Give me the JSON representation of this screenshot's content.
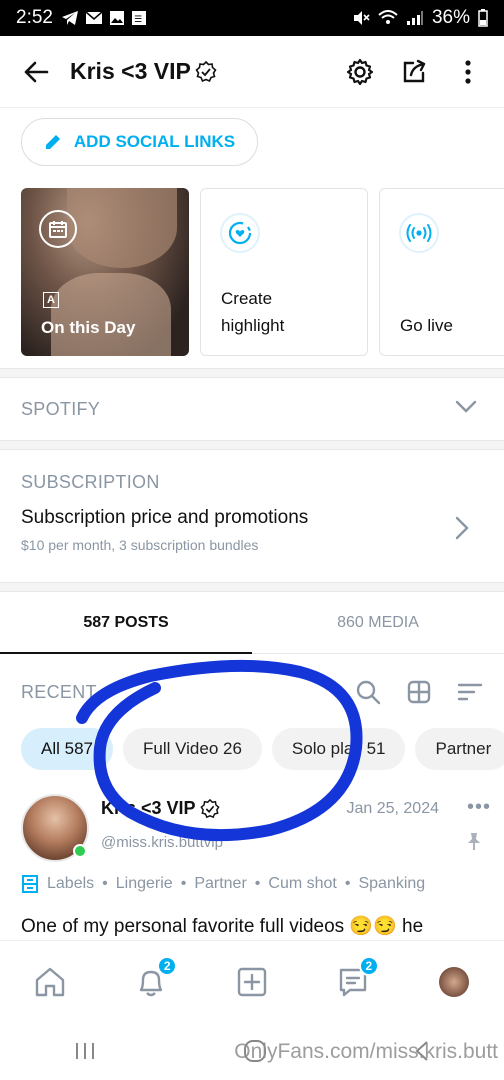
{
  "status_bar": {
    "time": "2:52",
    "battery": "36%"
  },
  "header": {
    "title": "Kris <3 VIP"
  },
  "social": {
    "label": "ADD SOCIAL LINKS"
  },
  "highlights": [
    {
      "label": "On this Day"
    },
    {
      "label": "Create highlight"
    },
    {
      "label": "Go live"
    }
  ],
  "spotify": {
    "title": "SPOTIFY"
  },
  "subscription": {
    "title": "SUBSCRIPTION",
    "main": "Subscription price and promotions",
    "detail": "$10 per month, 3 subscription bundles"
  },
  "tabs": {
    "posts": "587 POSTS",
    "media": "860 MEDIA"
  },
  "recent": {
    "label": "RECENT"
  },
  "chips": [
    {
      "label": "All 587",
      "active": true
    },
    {
      "label": "Full Video 26",
      "active": false
    },
    {
      "label": "Solo play 51",
      "active": false
    },
    {
      "label": "Partner",
      "active": false
    }
  ],
  "post": {
    "name": "Kris <3 VIP",
    "handle": "@miss.kris.buttvip",
    "date": "Jan 25, 2024",
    "labels_title": "Labels",
    "labels": [
      "Lingerie",
      "Partner",
      "Cum shot",
      "Spanking"
    ],
    "text": "One of my personal favorite full videos 😏😏 he"
  },
  "bottom_nav": {
    "notifications_badge": "2",
    "messages_badge": "2"
  },
  "watermark": "OnlyFans.com/miss.kris.butt",
  "colors": {
    "accent": "#00aff0",
    "muted": "#8a96a3",
    "annotation": "#1436d8"
  }
}
